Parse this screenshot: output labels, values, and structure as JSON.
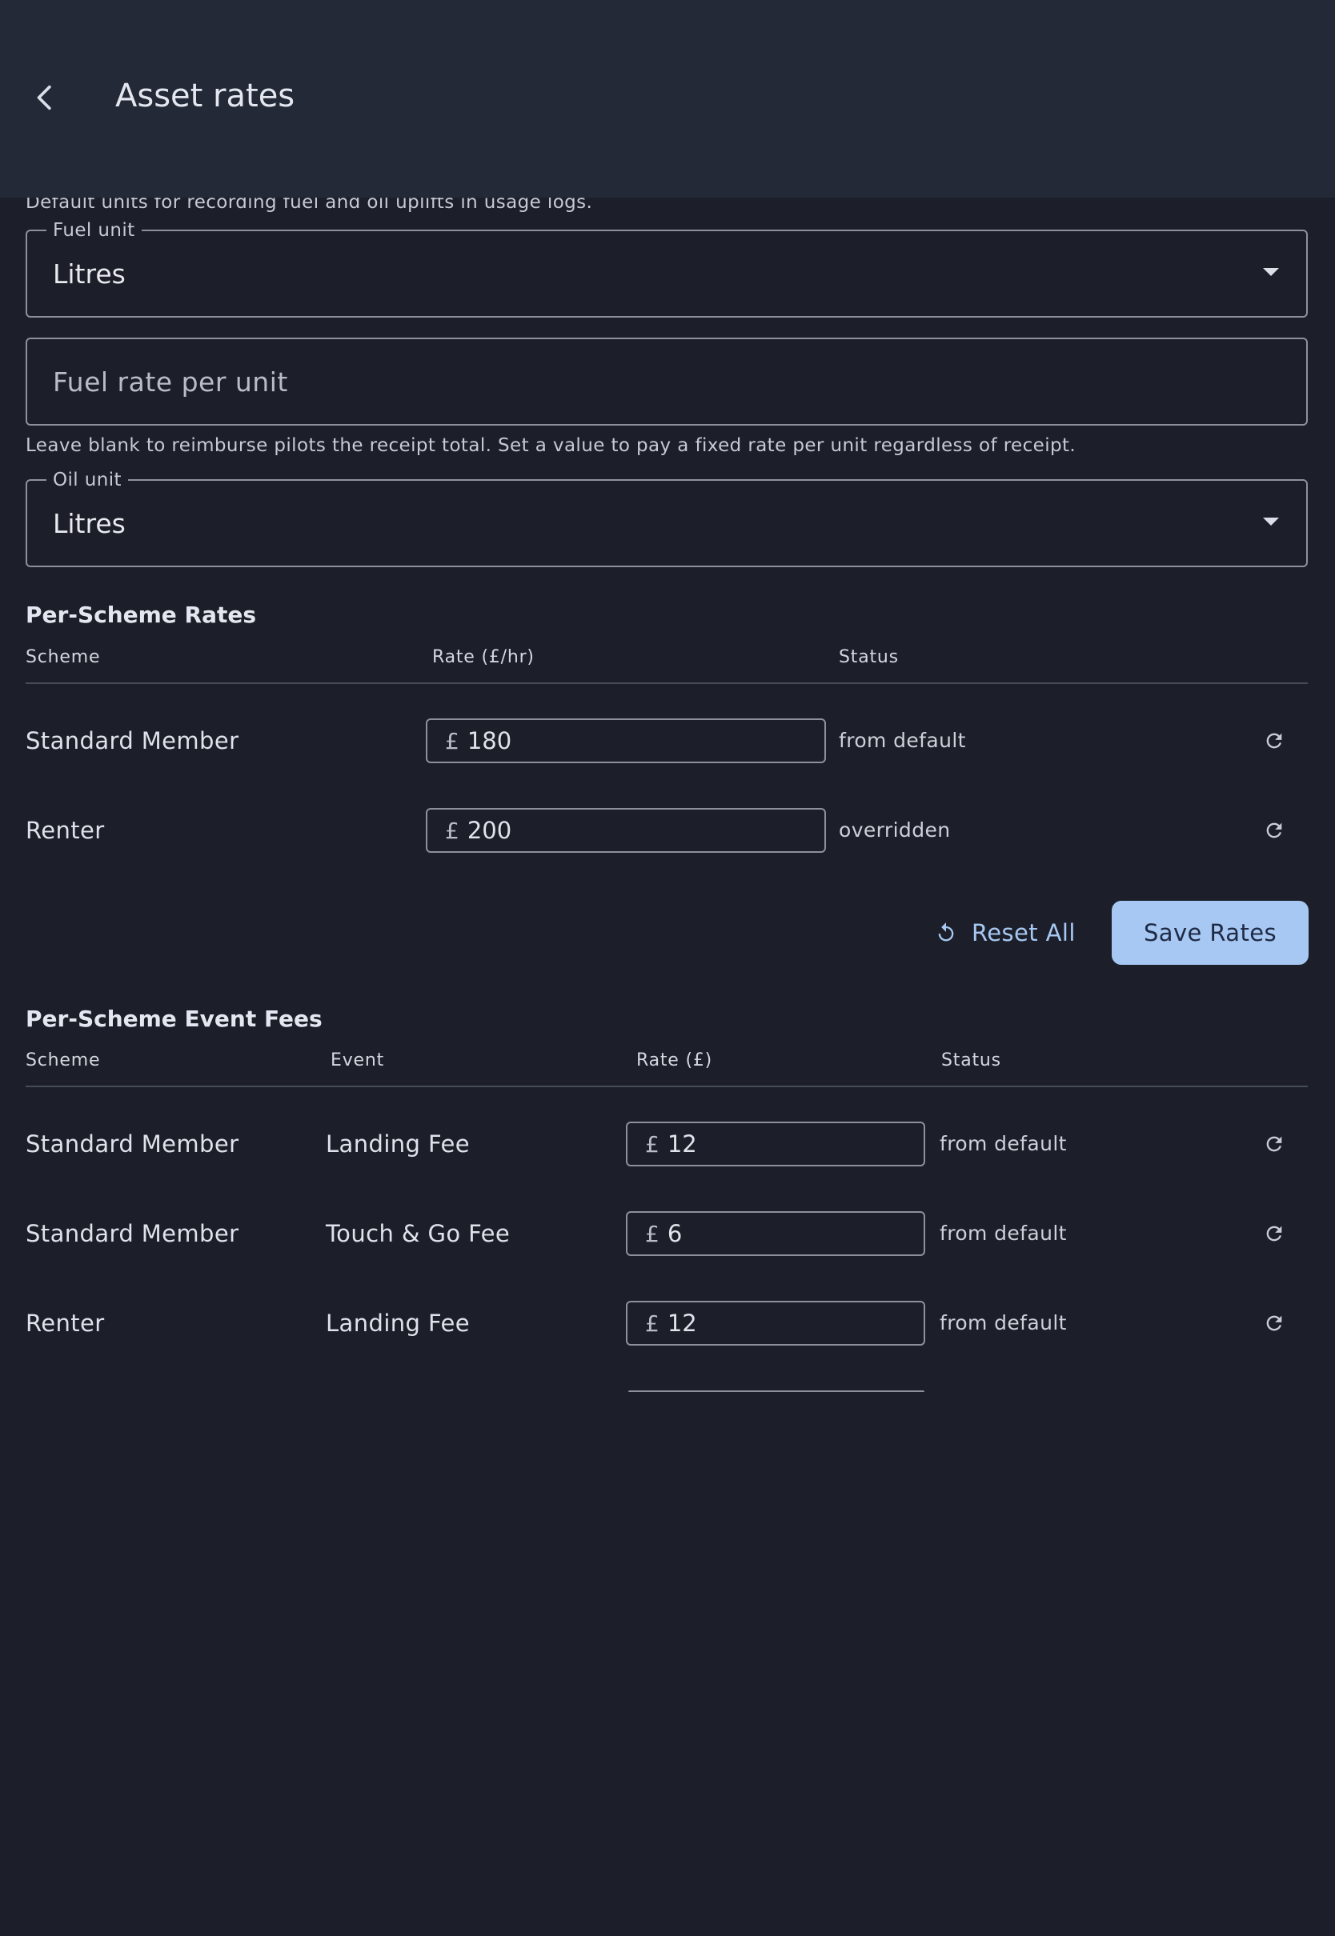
{
  "appbar": {
    "title": "Asset rates",
    "back_icon": "chevron-left-icon"
  },
  "units": {
    "helper": "Default units for recording fuel and oil uplifts in usage logs.",
    "fuel_unit": {
      "label": "Fuel unit",
      "value": "Litres"
    },
    "fuel_rate": {
      "placeholder": "Fuel rate per unit",
      "helper": "Leave blank to reimburse pilots the receipt total. Set a value to pay a fixed rate per unit regardless of receipt."
    },
    "oil_unit": {
      "label": "Oil unit",
      "value": "Litres"
    }
  },
  "scheme_rates": {
    "title": "Per-Scheme Rates",
    "columns": [
      "Scheme",
      "Rate (£/hr)",
      "Status"
    ],
    "currency": "£",
    "rows": [
      {
        "scheme": "Standard Member",
        "rate": "180",
        "status": "from default"
      },
      {
        "scheme": "Renter",
        "rate": "200",
        "status": "overridden"
      }
    ],
    "reset_all_label": "Reset All",
    "save_label": "Save Rates"
  },
  "event_fees": {
    "title": "Per-Scheme Event Fees",
    "columns": [
      "Scheme",
      "Event",
      "Rate (£)",
      "Status"
    ],
    "currency": "£",
    "rows": [
      {
        "scheme": "Standard Member",
        "event": "Landing Fee",
        "rate": "12",
        "status": "from default"
      },
      {
        "scheme": "Standard Member",
        "event": "Touch & Go Fee",
        "rate": "6",
        "status": "from default"
      },
      {
        "scheme": "Renter",
        "event": "Landing Fee",
        "rate": "12",
        "status": "from default"
      }
    ]
  },
  "colors": {
    "background": "#1c1f29",
    "appbar": "#242938",
    "accent": "#a7c8f2",
    "outline": "#8d919c"
  }
}
